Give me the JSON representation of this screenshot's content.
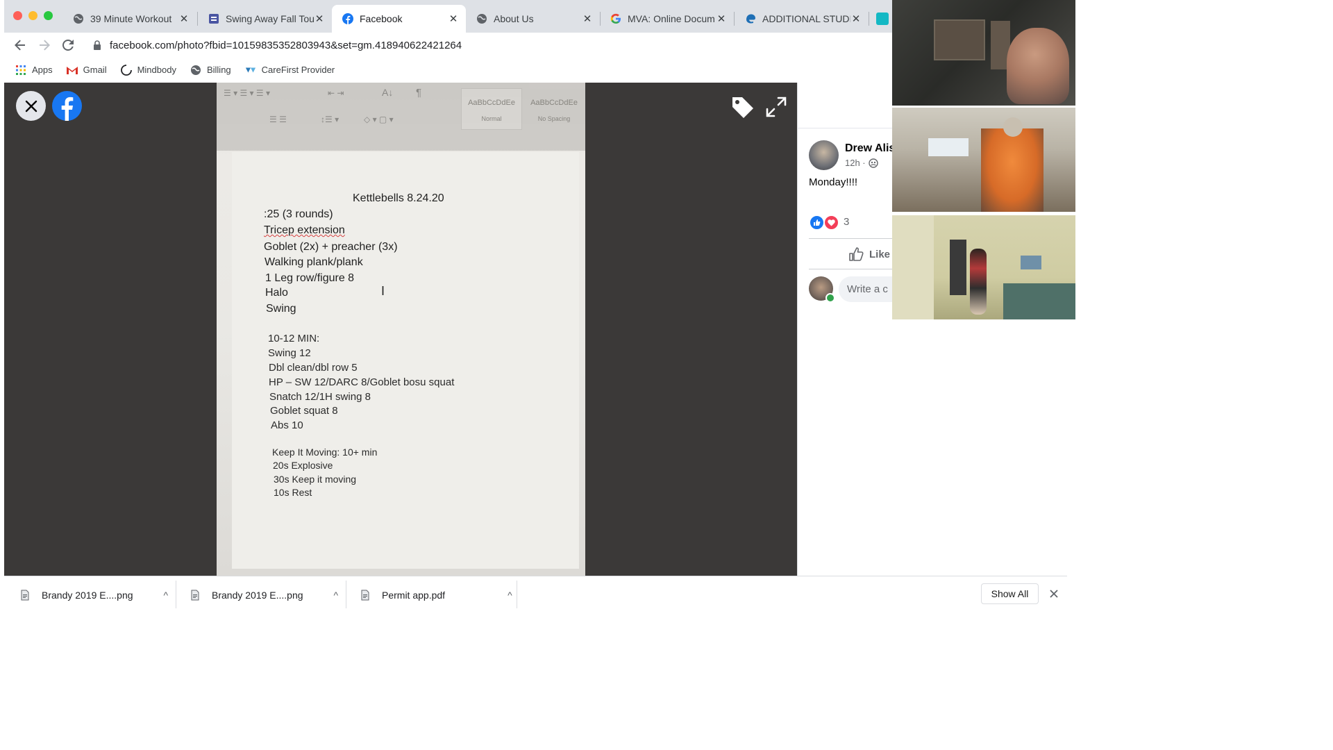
{
  "browser": {
    "tabs": [
      {
        "title": "39 Minute Workout",
        "icon": "globe-icon",
        "active": false
      },
      {
        "title": "Swing Away Fall Tou",
        "icon": "forms-icon",
        "active": false
      },
      {
        "title": "Facebook",
        "icon": "facebook-icon",
        "active": true
      },
      {
        "title": "About Us",
        "icon": "globe-icon",
        "active": false
      },
      {
        "title": "MVA: Online Docum",
        "icon": "google-icon",
        "active": false
      },
      {
        "title": "ADDITIONAL STUDI",
        "icon": "edge-icon",
        "active": false
      }
    ],
    "url": "facebook.com/photo?fbid=10159835352803943&set=gm.418940622421264",
    "bookmarks": [
      {
        "label": "Apps",
        "icon": "apps-grid-icon"
      },
      {
        "label": "Gmail",
        "icon": "gmail-icon"
      },
      {
        "label": "Mindbody",
        "icon": "mindbody-icon"
      },
      {
        "label": "Billing",
        "icon": "globe-icon"
      },
      {
        "label": "CareFirst Provider",
        "icon": "carefirst-icon"
      }
    ]
  },
  "photo": {
    "ribbon": {
      "style_normal": "AaBbCcDdEe",
      "style_normal_label": "Normal",
      "style_nospacing": "AaBbCcDdEe",
      "style_nospacing_label": "No Spacing"
    },
    "doc_title": "Kettlebells 8.24.20",
    "lines": [
      ":25 (3 rounds)",
      "Tricep extension",
      "Goblet (2x) + preacher (3x)",
      "Walking plank/plank",
      "1 Leg row/figure 8",
      "Halo",
      "Swing",
      "10-12 MIN:",
      "Swing 12",
      "Dbl clean/dbl row 5",
      "HP – SW 12/DARC 8/Goblet bosu squat",
      "Snatch 12/1H swing 8",
      "Goblet squat 8",
      "Abs 10",
      "Keep It Moving: 10+ min",
      "20s Explosive",
      "30s Keep it moving",
      "10s Rest"
    ]
  },
  "post": {
    "author": "Drew Alis",
    "time": "12h ·",
    "text": "Monday!!!!",
    "reaction_count": "3",
    "like_label": "Like",
    "comment_placeholder": "Write a c"
  },
  "downloads": {
    "items": [
      "Brandy 2019 E....png",
      "Brandy 2019 E....png",
      "Permit app.pdf"
    ],
    "show_all": "Show All"
  },
  "colors": {
    "facebook_blue": "#1877f2",
    "love_red": "#f33e58",
    "tabbar": "#dee1e6",
    "viewer_bg": "#3b3938"
  }
}
